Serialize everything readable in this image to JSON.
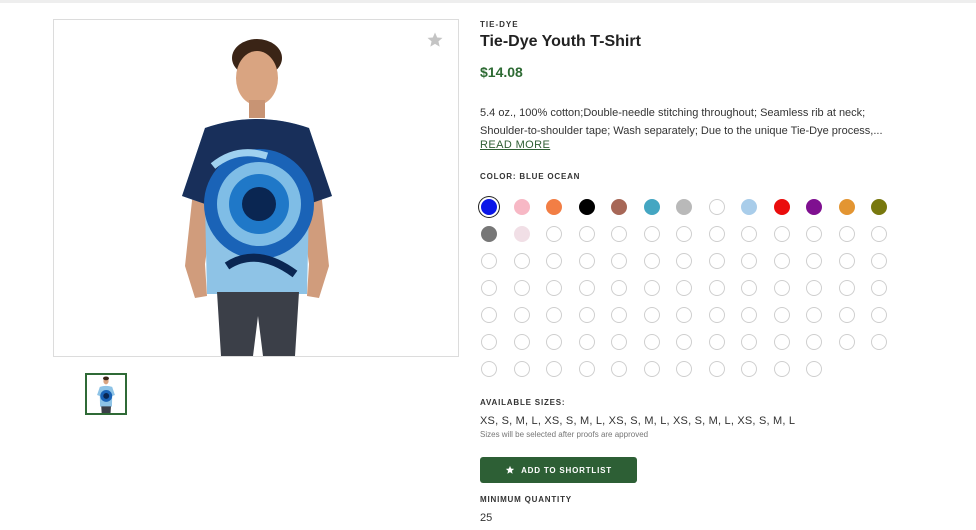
{
  "product": {
    "brand": "TIE-DYE",
    "title": "Tie-Dye Youth T-Shirt",
    "price": "$14.08",
    "description_line1": "5.4 oz., 100% cotton;Double-needle stitching throughout; Seamless rib at neck;",
    "description_line2": "Shoulder-to-shoulder tape; Wash separately; Due to the unique Tie-Dye process,...",
    "read_more": "READ MORE"
  },
  "color": {
    "label": "COLOR: BLUE OCEAN",
    "selected_index": 0,
    "swatches": [
      "#0b16e8",
      "#f7b8c5",
      "#f27e45",
      "#000000",
      "#a76757",
      "#44a6c2",
      "#b9b9b9",
      "#ffffff",
      "#a9cdea",
      "#ea0d0d",
      "#7f1090",
      "#e39532",
      "#78780e",
      "#777777",
      "#f1dfe6"
    ],
    "empty_swatch_count": 74
  },
  "sizes": {
    "label": "AVAILABLE SIZES:",
    "values": "XS, S, M, L, XS, S, M, L, XS, S, M, L, XS, S, M, L, XS, S, M, L",
    "note": "Sizes will be selected after proofs are approved"
  },
  "shortlist_button": {
    "label": "ADD TO SHORTLIST",
    "icon": "star-icon"
  },
  "minimum_quantity": {
    "label": "MINIMUM QUANTITY",
    "value": "25"
  },
  "accent_color": "#2d5f35"
}
